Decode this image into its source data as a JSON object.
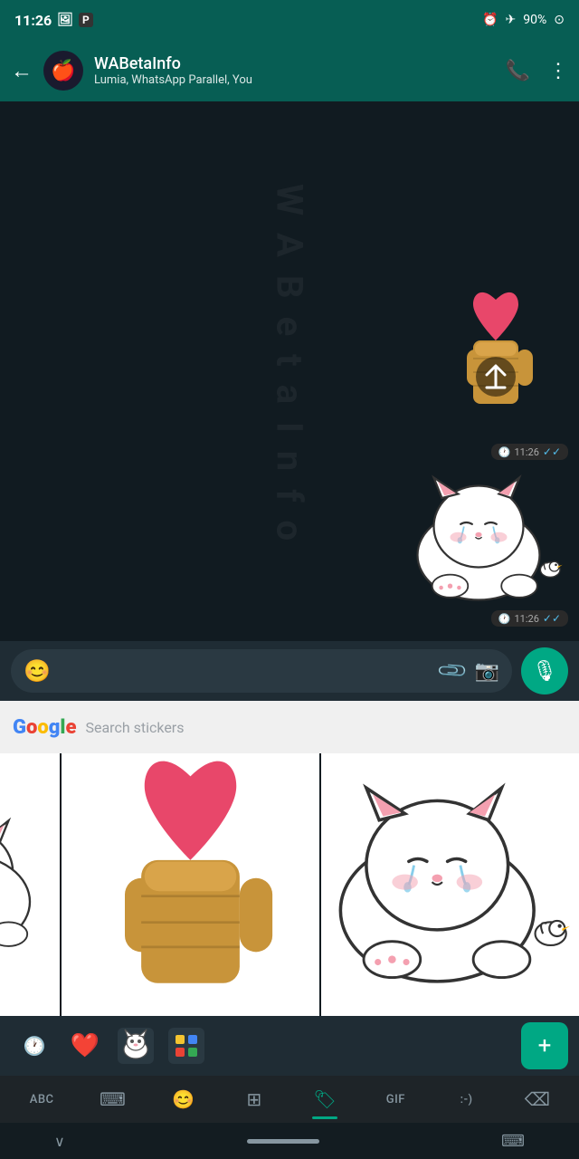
{
  "statusBar": {
    "time": "11:26",
    "battery": "90%",
    "batteryIcon": "🔋"
  },
  "toolbar": {
    "backLabel": "←",
    "contactName": "WABetaInfo",
    "contactStatus": "Lumia, WhatsApp Parallel, You",
    "callIcon": "📞+",
    "menuIcon": "⋮"
  },
  "messages": [
    {
      "type": "sticker",
      "stickerType": "heart-hand",
      "time": "11:26",
      "ticks": "✓✓"
    },
    {
      "type": "sticker",
      "stickerType": "cat-crying",
      "time": "11:26",
      "ticks": "✓✓"
    }
  ],
  "inputArea": {
    "emojiIcon": "😊",
    "placeholder": "",
    "attachIcon": "📎",
    "cameraIcon": "📷",
    "micIcon": "🎙"
  },
  "stickerSearch": {
    "googleLetter": "G",
    "placeholder": "Search stickers"
  },
  "stickerGrid": {
    "cols": [
      "partial-cat",
      "heart-hand",
      "cat-crying"
    ]
  },
  "stickerTabs": [
    {
      "icon": "🕐",
      "label": "recent",
      "active": false
    },
    {
      "icon": "❤️",
      "label": "hearts",
      "active": false
    },
    {
      "icon": "🐱",
      "label": "cat",
      "active": false
    },
    {
      "icon": "🎨",
      "label": "color",
      "active": false
    }
  ],
  "addStickerLabel": "+",
  "keyboardToolbar": {
    "items": [
      {
        "label": "ABC",
        "type": "text",
        "active": false
      },
      {
        "icon": "⌨",
        "type": "icon",
        "active": false
      },
      {
        "icon": "😊",
        "type": "icon",
        "active": false
      },
      {
        "icon": "⊞",
        "type": "icon",
        "active": false
      },
      {
        "icon": "🏷",
        "type": "icon",
        "active": true
      },
      {
        "label": "GIF",
        "type": "text",
        "active": false
      },
      {
        "label": ":-)",
        "type": "text",
        "active": false
      },
      {
        "icon": "⌫",
        "type": "backspace",
        "active": false
      }
    ]
  },
  "bottomNav": {
    "chevron": "∨",
    "keyboard": "⌨"
  }
}
